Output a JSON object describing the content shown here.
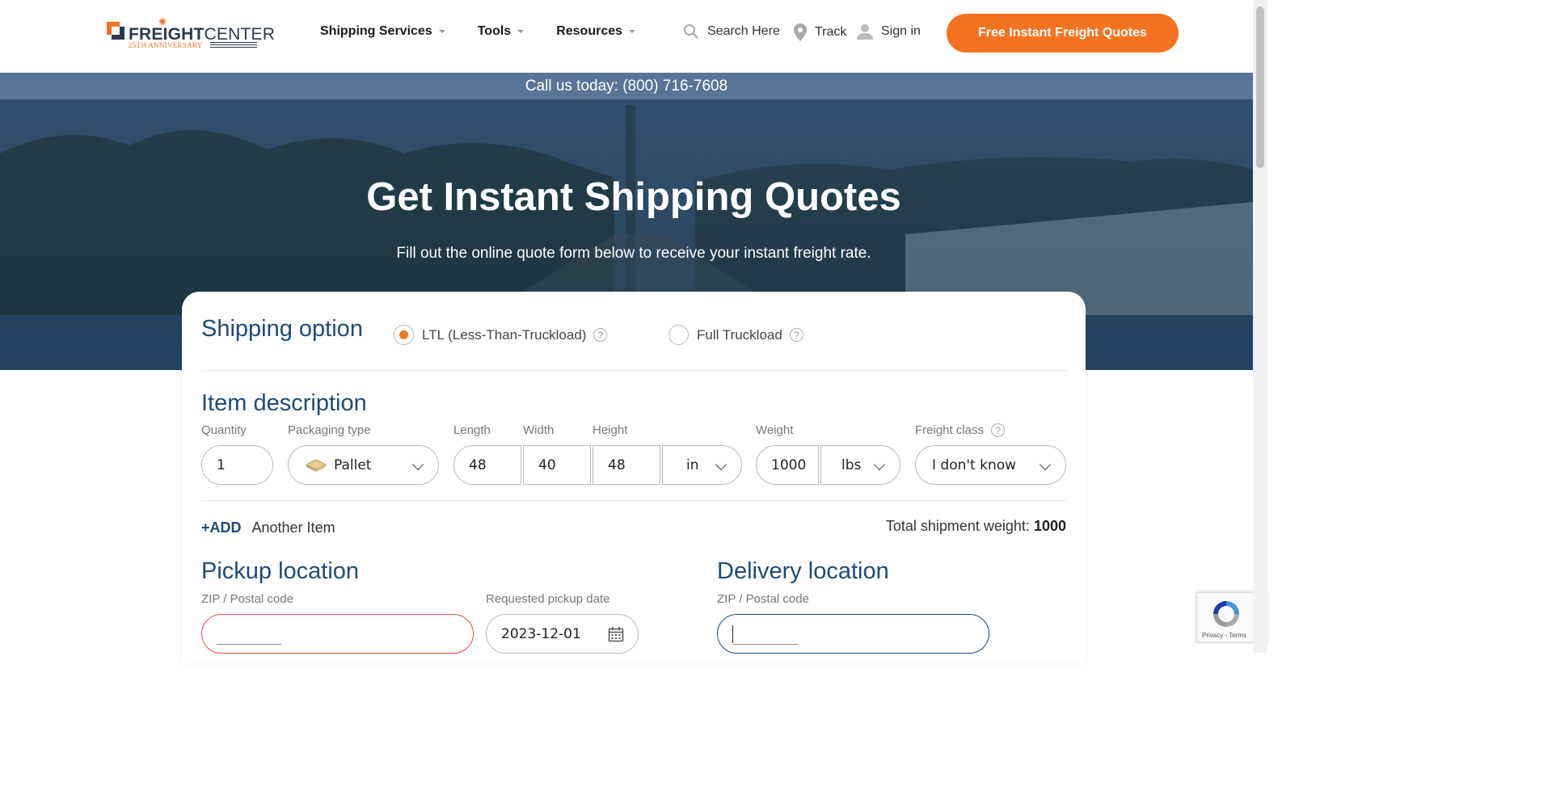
{
  "header": {
    "logo": {
      "brand_bold": "FREIGHT",
      "brand_light": "CENTER",
      "tagline": "25TH ANNIVERSARY"
    },
    "nav": [
      {
        "label": "Shipping Services"
      },
      {
        "label": "Tools"
      },
      {
        "label": "Resources"
      }
    ],
    "search_label": "Search Here",
    "track_label": "Track",
    "signin_label": "Sign in",
    "cta_label": "Free Instant Freight Quotes"
  },
  "hero": {
    "call_text": "Call us today: (800) 716-7608",
    "title": "Get Instant Shipping Quotes",
    "subtitle": "Fill out the online quote form below to receive your instant freight rate."
  },
  "form": {
    "shipping_option": {
      "title": "Shipping option",
      "options": [
        {
          "label": "LTL (Less-Than-Truckload)",
          "selected": true
        },
        {
          "label": "Full Truckload",
          "selected": false
        }
      ]
    },
    "item": {
      "title": "Item description",
      "labels": {
        "quantity": "Quantity",
        "packaging": "Packaging type",
        "length": "Length",
        "width": "Width",
        "height": "Height",
        "weight": "Weight",
        "freight_class": "Freight class"
      },
      "values": {
        "quantity": "1",
        "packaging": "Pallet",
        "length": "48",
        "width": "40",
        "height": "48",
        "dim_unit": "in",
        "weight": "1000",
        "weight_unit": "lbs",
        "freight_class": "I don't know"
      }
    },
    "add": {
      "prefix": "+ADD",
      "label": "Another Item"
    },
    "total": {
      "label": "Total shipment weight:",
      "value": "1000"
    },
    "pickup": {
      "title": "Pickup location",
      "zip_label": "ZIP / Postal code",
      "date_label": "Requested pickup date",
      "date_value": "2023-12-01"
    },
    "delivery": {
      "title": "Delivery location",
      "zip_label": "ZIP / Postal code"
    }
  },
  "recaptcha": {
    "terms": "Privacy - Terms"
  },
  "colors": {
    "accent": "#f47321",
    "brand_blue": "#1f4a78",
    "hero_overlay": "#1c3e66"
  }
}
